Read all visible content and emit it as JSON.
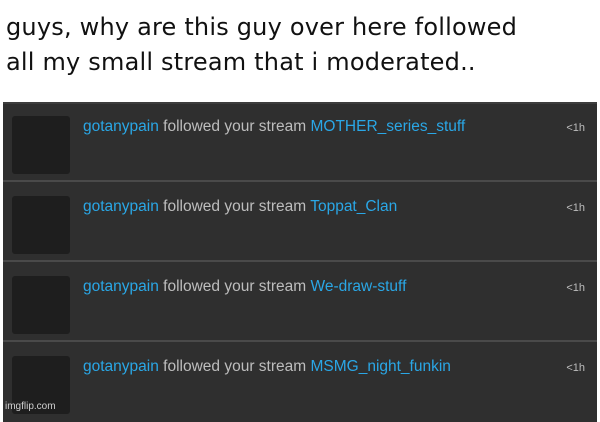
{
  "caption": {
    "line1": "guys, why are this guy over here followed",
    "line2": "all my small stream that i moderated.."
  },
  "feed": {
    "items": [
      {
        "user": "gotanypain",
        "action": "followed your stream",
        "stream": "MOTHER_series_stuff",
        "time": "<1h"
      },
      {
        "user": "gotanypain",
        "action": "followed your stream",
        "stream": "Toppat_Clan",
        "time": "<1h"
      },
      {
        "user": "gotanypain",
        "action": "followed your stream",
        "stream": "We-draw-stuff",
        "time": "<1h"
      },
      {
        "user": "gotanypain",
        "action": "followed your stream",
        "stream": "MSMG_night_funkin",
        "time": "<1h"
      }
    ]
  },
  "watermark": "imgflip.com",
  "colors": {
    "link": "#2aa7e6",
    "text": "#bdbdbd",
    "background": "#2f2f2f"
  }
}
